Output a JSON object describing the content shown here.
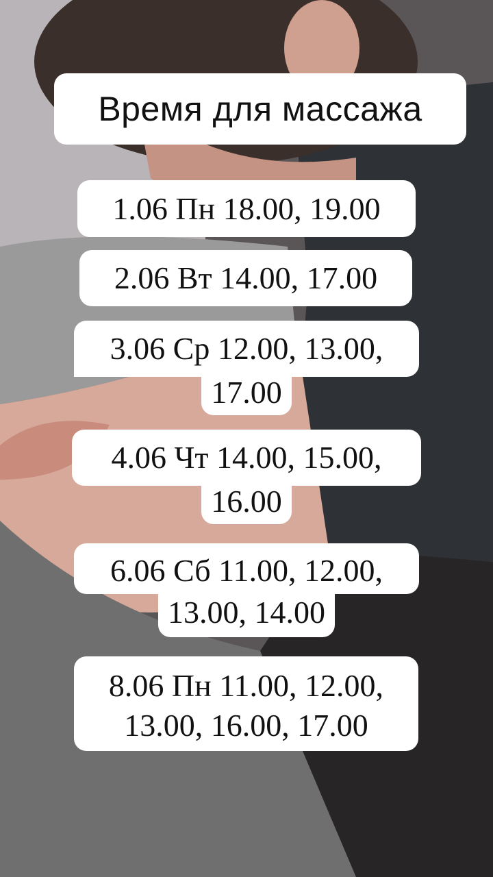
{
  "header": {
    "title": "Время для массажа"
  },
  "schedule": {
    "items": [
      {
        "lines": [
          "1.06 Пн 18.00, 19.00"
        ]
      },
      {
        "lines": [
          "2.06 Вт 14.00, 17.00"
        ]
      },
      {
        "lines": [
          "3.06 Ср 12.00, 13.00,",
          "17.00"
        ]
      },
      {
        "lines": [
          "4.06 Чт 14.00, 15.00,",
          "16.00"
        ]
      },
      {
        "lines": [
          "6.06 Сб 11.00, 12.00,",
          "13.00, 14.00"
        ]
      },
      {
        "lines": [
          "8.06 Пн 11.00, 12.00,",
          "13.00, 16.00, 17.00"
        ]
      }
    ]
  },
  "colors": {
    "pill_background": "#ffffff",
    "text": "#111111"
  }
}
